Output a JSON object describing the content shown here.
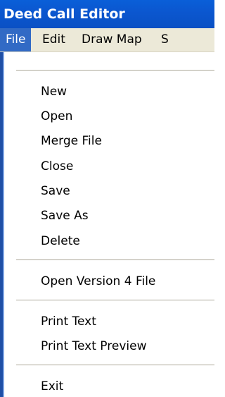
{
  "window": {
    "title": "Deed Call Editor"
  },
  "menubar": {
    "items": [
      {
        "label": "File"
      },
      {
        "label": "Edit"
      },
      {
        "label": "Draw Map"
      },
      {
        "label": "S"
      }
    ]
  },
  "file_menu": {
    "groups": [
      [
        "New",
        "Open",
        "Merge File",
        "Close",
        "Save",
        "Save As",
        "Delete"
      ],
      [
        "Open Version 4 File"
      ],
      [
        "Print Text",
        "Print Text Preview"
      ],
      [
        "Exit"
      ]
    ]
  },
  "colors": {
    "titlebar": "#0b57d0",
    "menu_highlight": "#316ac5",
    "menubar_bg": "#ece9d8"
  }
}
